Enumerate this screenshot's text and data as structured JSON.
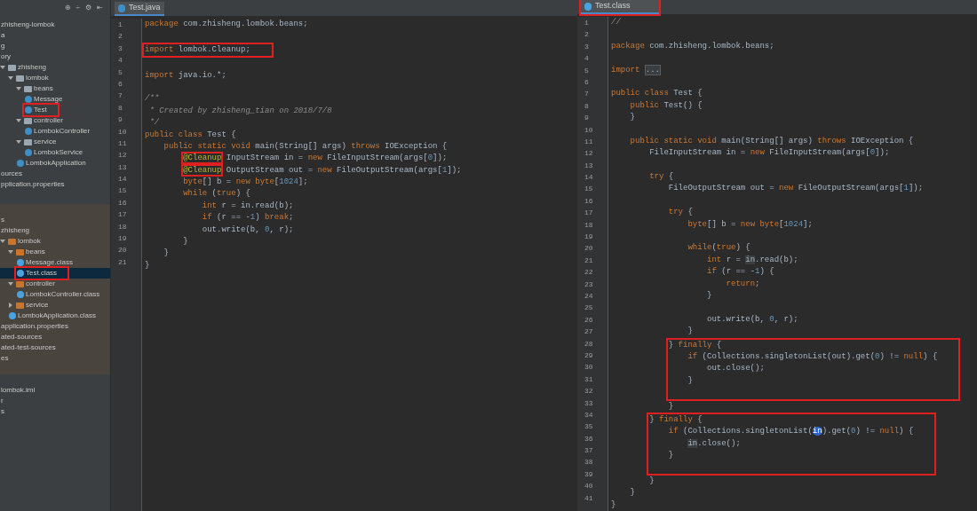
{
  "sidebar": {
    "toolbar": [
      "⊕",
      "÷",
      "⚙",
      "⇤"
    ],
    "sections": [
      {
        "kind": "source",
        "nodes": [
          {
            "kind": "text",
            "label": "zhisheng-lombok"
          },
          {
            "kind": "text",
            "label": "a"
          },
          {
            "kind": "text",
            "label": "g"
          },
          {
            "kind": "text",
            "label": "ory"
          },
          {
            "kind": "folder",
            "label": "zhisheng",
            "expanded": true,
            "children": [
              {
                "kind": "folder",
                "label": "lombok",
                "expanded": true,
                "children": [
                  {
                    "kind": "folder",
                    "label": "beans",
                    "expanded": true,
                    "children": [
                      {
                        "kind": "java",
                        "label": "Message",
                        "selected": false,
                        "boxed": false
                      },
                      {
                        "kind": "java",
                        "label": "Test",
                        "selected": false,
                        "boxed": true
                      }
                    ]
                  },
                  {
                    "kind": "folder",
                    "label": "controller",
                    "expanded": true,
                    "children": [
                      {
                        "kind": "java",
                        "label": "LombokController",
                        "selected": false,
                        "boxed": false
                      }
                    ]
                  },
                  {
                    "kind": "folder",
                    "label": "service",
                    "expanded": true,
                    "children": [
                      {
                        "kind": "java",
                        "label": "LombokService",
                        "selected": false,
                        "boxed": false
                      }
                    ]
                  },
                  {
                    "kind": "java",
                    "label": "LombokApplication",
                    "selected": false,
                    "boxed": false
                  }
                ]
              }
            ]
          },
          {
            "kind": "text",
            "label": "ources"
          },
          {
            "kind": "text",
            "label": "pplication.properties"
          }
        ]
      },
      {
        "kind": "excluded",
        "nodes": [
          {
            "kind": "text",
            "label": "s"
          },
          {
            "kind": "text",
            "label": "zhisheng"
          },
          {
            "kind": "folder",
            "label": "lombok",
            "expanded": true,
            "children": [
              {
                "kind": "folder",
                "label": "beans",
                "expanded": true,
                "children": [
                  {
                    "kind": "class",
                    "label": "Message.class",
                    "selected": false,
                    "boxed": false
                  },
                  {
                    "kind": "class",
                    "label": "Test.class",
                    "selected": true,
                    "boxed": true
                  }
                ]
              },
              {
                "kind": "folder",
                "label": "controller",
                "expanded": true,
                "children": [
                  {
                    "kind": "class",
                    "label": "LombokController.class",
                    "selected": false,
                    "boxed": false
                  }
                ]
              },
              {
                "kind": "folder",
                "label": "service",
                "expanded": false
              },
              {
                "kind": "class",
                "label": "LombokApplication.class",
                "selected": false,
                "boxed": false
              }
            ]
          },
          {
            "kind": "text",
            "label": "application.properties"
          },
          {
            "kind": "text",
            "label": "ated-sources"
          },
          {
            "kind": "text",
            "label": "ated-test-sources"
          },
          {
            "kind": "text",
            "label": "es"
          }
        ]
      },
      {
        "kind": "plain",
        "nodes": [
          {
            "kind": "text",
            "label": "lombok.iml"
          },
          {
            "kind": "text",
            "label": "r"
          },
          {
            "kind": "text",
            "label": "s"
          }
        ]
      }
    ]
  },
  "editors": [
    {
      "tab": {
        "label": "Test.java",
        "selected": true,
        "boxed": false,
        "kind": "java"
      },
      "lines": [
        {
          "n": "1",
          "tokens": [
            {
              "kind": "k",
              "text": "package"
            },
            {
              "kind": "t",
              "text": " com.zhisheng.lombok.beans;"
            }
          ]
        },
        {
          "n": "2"
        },
        {
          "n": "3",
          "boxed": true,
          "tokens": [
            {
              "kind": "k",
              "text": "import"
            },
            {
              "kind": "t",
              "text": " lombok.Cleanup;"
            }
          ]
        },
        {
          "n": "4"
        },
        {
          "n": "5",
          "tokens": [
            {
              "kind": "k",
              "text": "import"
            },
            {
              "kind": "t",
              "text": " java.io.*;"
            }
          ]
        },
        {
          "n": "6"
        },
        {
          "n": "7",
          "tokens": [
            {
              "kind": "c",
              "text": "/**"
            }
          ]
        },
        {
          "n": "8",
          "tokens": [
            {
              "kind": "c",
              "text": " * Created by zhisheng_tian on 2018/7/8"
            }
          ]
        },
        {
          "n": "9",
          "tokens": [
            {
              "kind": "c",
              "text": " */"
            }
          ]
        },
        {
          "n": "10",
          "tokens": [
            {
              "kind": "k",
              "text": "public class"
            },
            {
              "kind": "t",
              "text": " Test {"
            }
          ]
        },
        {
          "n": "11",
          "tokens": [
            {
              "kind": "k",
              "text": "    public static void"
            },
            {
              "kind": "t",
              "text": " main(String[] args) "
            },
            {
              "kind": "k",
              "text": "throws"
            },
            {
              "kind": "t",
              "text": " IOException {"
            }
          ]
        },
        {
          "n": "12",
          "tokens": [
            {
              "kind": "ab",
              "text": "        @Cleanup"
            },
            {
              "kind": "t",
              "text": " InputStream in = "
            },
            {
              "kind": "k",
              "text": "new"
            },
            {
              "kind": "t",
              "text": " FileInputStream(args["
            },
            {
              "kind": "num",
              "text": "0"
            },
            {
              "kind": "t",
              "text": "]);"
            }
          ]
        },
        {
          "n": "13",
          "tokens": [
            {
              "kind": "ab",
              "text": "        @Cleanup"
            },
            {
              "kind": "t",
              "text": " OutputStream out = "
            },
            {
              "kind": "k",
              "text": "new"
            },
            {
              "kind": "t",
              "text": " FileOutputStream(args["
            },
            {
              "kind": "num",
              "text": "1"
            },
            {
              "kind": "t",
              "text": "]);"
            }
          ]
        },
        {
          "n": "14",
          "tokens": [
            {
              "kind": "k",
              "text": "        byte"
            },
            {
              "kind": "t",
              "text": "[] b = "
            },
            {
              "kind": "k",
              "text": "new byte"
            },
            {
              "kind": "t",
              "text": "["
            },
            {
              "kind": "num",
              "text": "1024"
            },
            {
              "kind": "t",
              "text": "];"
            }
          ]
        },
        {
          "n": "15",
          "tokens": [
            {
              "kind": "k",
              "text": "        while"
            },
            {
              "kind": "t",
              "text": " ("
            },
            {
              "kind": "k",
              "text": "true"
            },
            {
              "kind": "t",
              "text": ") {"
            }
          ]
        },
        {
          "n": "16",
          "tokens": [
            {
              "kind": "k",
              "text": "            int"
            },
            {
              "kind": "t",
              "text": " r = in.read(b);"
            }
          ]
        },
        {
          "n": "17",
          "tokens": [
            {
              "kind": "k",
              "text": "            if"
            },
            {
              "kind": "t",
              "text": " (r == -"
            },
            {
              "kind": "num",
              "text": "1"
            },
            {
              "kind": "t",
              "text": ") "
            },
            {
              "kind": "k",
              "text": "break"
            },
            {
              "kind": "t",
              "text": ";"
            }
          ]
        },
        {
          "n": "18",
          "tokens": [
            {
              "kind": "t",
              "text": "            out.write(b, "
            },
            {
              "kind": "num",
              "text": "0"
            },
            {
              "kind": "t",
              "text": ", r);"
            }
          ]
        },
        {
          "n": "19",
          "tokens": [
            {
              "kind": "t",
              "text": "        }"
            }
          ]
        },
        {
          "n": "20",
          "tokens": [
            {
              "kind": "t",
              "text": "    }"
            }
          ]
        },
        {
          "n": "21",
          "tokens": [
            {
              "kind": "t",
              "text": "}"
            }
          ]
        }
      ]
    },
    {
      "tab": {
        "label": "Test.class",
        "selected": true,
        "boxed": true,
        "kind": "class"
      },
      "lines": [
        {
          "n": "1",
          "tokens": [
            {
              "kind": "c",
              "text": "//"
            }
          ]
        },
        {
          "n": "2"
        },
        {
          "n": "3",
          "tokens": [
            {
              "kind": "k",
              "text": "package"
            },
            {
              "kind": "t",
              "text": " com.zhisheng.lombok.beans;"
            }
          ]
        },
        {
          "n": "4"
        },
        {
          "n": "5",
          "tokens": [
            {
              "kind": "k",
              "text": "import "
            },
            {
              "kind": "fold",
              "text": "..."
            }
          ]
        },
        {
          "n": "6"
        },
        {
          "n": "7",
          "tokens": [
            {
              "kind": "k",
              "text": "public class"
            },
            {
              "kind": "t",
              "text": " Test {"
            }
          ]
        },
        {
          "n": "8",
          "tokens": [
            {
              "kind": "k",
              "text": "    public"
            },
            {
              "kind": "t",
              "text": " Test() {"
            }
          ]
        },
        {
          "n": "9",
          "tokens": [
            {
              "kind": "t",
              "text": "    }"
            }
          ]
        },
        {
          "n": "10"
        },
        {
          "n": "11",
          "tokens": [
            {
              "kind": "k",
              "text": "    public static void"
            },
            {
              "kind": "t",
              "text": " main(String[] args) "
            },
            {
              "kind": "k",
              "text": "throws"
            },
            {
              "kind": "t",
              "text": " IOException {"
            }
          ]
        },
        {
          "n": "12",
          "tokens": [
            {
              "kind": "t",
              "text": "        FileInputStream in = "
            },
            {
              "kind": "k",
              "text": "new"
            },
            {
              "kind": "t",
              "text": " FileInputStream(args["
            },
            {
              "kind": "num",
              "text": "0"
            },
            {
              "kind": "t",
              "text": "]);"
            }
          ]
        },
        {
          "n": "13"
        },
        {
          "n": "14",
          "tokens": [
            {
              "kind": "k",
              "text": "        try"
            },
            {
              "kind": "t",
              "text": " {"
            }
          ]
        },
        {
          "n": "15",
          "tokens": [
            {
              "kind": "t",
              "text": "            FileOutputStream out = "
            },
            {
              "kind": "k",
              "text": "new"
            },
            {
              "kind": "t",
              "text": " FileOutputStream(args["
            },
            {
              "kind": "num",
              "text": "1"
            },
            {
              "kind": "t",
              "text": "]);"
            }
          ]
        },
        {
          "n": "16"
        },
        {
          "n": "17",
          "tokens": [
            {
              "kind": "k",
              "text": "            try"
            },
            {
              "kind": "t",
              "text": " {"
            }
          ]
        },
        {
          "n": "18",
          "tokens": [
            {
              "kind": "k",
              "text": "                byte"
            },
            {
              "kind": "t",
              "text": "[] b = "
            },
            {
              "kind": "k",
              "text": "new byte"
            },
            {
              "kind": "t",
              "text": "["
            },
            {
              "kind": "num",
              "text": "1024"
            },
            {
              "kind": "t",
              "text": "];"
            }
          ]
        },
        {
          "n": "19"
        },
        {
          "n": "20",
          "tokens": [
            {
              "kind": "k",
              "text": "                while"
            },
            {
              "kind": "t",
              "text": "("
            },
            {
              "kind": "k",
              "text": "true"
            },
            {
              "kind": "t",
              "text": ") {"
            }
          ]
        },
        {
          "n": "21",
          "tokens": [
            {
              "kind": "k",
              "text": "                    int"
            },
            {
              "kind": "t",
              "text": " r = "
            },
            {
              "kind": "hl",
              "text": "in"
            },
            {
              "kind": "t",
              "text": ".read(b);"
            }
          ]
        },
        {
          "n": "22",
          "tokens": [
            {
              "kind": "k",
              "text": "                    if"
            },
            {
              "kind": "t",
              "text": " (r == -"
            },
            {
              "kind": "num",
              "text": "1"
            },
            {
              "kind": "t",
              "text": ") {"
            }
          ]
        },
        {
          "n": "23",
          "tokens": [
            {
              "kind": "k",
              "text": "                        return"
            },
            {
              "kind": "t",
              "text": ";"
            }
          ]
        },
        {
          "n": "24",
          "tokens": [
            {
              "kind": "t",
              "text": "                    }"
            }
          ]
        },
        {
          "n": "25"
        },
        {
          "n": "26",
          "tokens": [
            {
              "kind": "t",
              "text": "                    out.write(b, "
            },
            {
              "kind": "num",
              "text": "0"
            },
            {
              "kind": "t",
              "text": ", r);"
            }
          ]
        },
        {
          "n": "27",
          "tokens": [
            {
              "kind": "t",
              "text": "                }"
            }
          ]
        },
        {
          "n": "28",
          "boxed": true,
          "tokens": [
            {
              "kind": "t",
              "text": "            } "
            },
            {
              "kind": "k",
              "text": "finally"
            },
            {
              "kind": "t",
              "text": " {"
            }
          ]
        },
        {
          "n": "29",
          "boxed": true,
          "tokens": [
            {
              "kind": "k",
              "text": "                if"
            },
            {
              "kind": "t",
              "text": " (Collections.singletonList(out).get("
            },
            {
              "kind": "num",
              "text": "0"
            },
            {
              "kind": "t",
              "text": ") != "
            },
            {
              "kind": "k",
              "text": "null"
            },
            {
              "kind": "t",
              "text": ") {"
            }
          ]
        },
        {
          "n": "30",
          "boxed": true,
          "tokens": [
            {
              "kind": "t",
              "text": "                    out.close();"
            }
          ]
        },
        {
          "n": "31",
          "boxed": true,
          "tokens": [
            {
              "kind": "t",
              "text": "                }"
            }
          ]
        },
        {
          "n": "32",
          "boxed": true
        },
        {
          "n": "33",
          "tokens": [
            {
              "kind": "t",
              "text": "            }"
            }
          ]
        },
        {
          "n": "34",
          "boxed": true,
          "tokens": [
            {
              "kind": "t",
              "text": "        } "
            },
            {
              "kind": "k",
              "text": "finally"
            },
            {
              "kind": "t",
              "text": " {"
            }
          ]
        },
        {
          "n": "35",
          "boxed": true,
          "tokens": [
            {
              "kind": "k",
              "text": "            if"
            },
            {
              "kind": "t",
              "text": " (Collections.singletonList("
            },
            {
              "kind": "sel",
              "text": "in"
            },
            {
              "kind": "t",
              "text": ").get("
            },
            {
              "kind": "num",
              "text": "0"
            },
            {
              "kind": "t",
              "text": ") != "
            },
            {
              "kind": "k",
              "text": "null"
            },
            {
              "kind": "t",
              "text": ") {"
            }
          ]
        },
        {
          "n": "36",
          "boxed": true,
          "tokens": [
            {
              "kind": "hl",
              "text": "                in"
            },
            {
              "kind": "t",
              "text": ".close();"
            }
          ]
        },
        {
          "n": "37",
          "boxed": true,
          "tokens": [
            {
              "kind": "t",
              "text": "            }"
            }
          ]
        },
        {
          "n": "38",
          "boxed": true
        },
        {
          "n": "39",
          "tokens": [
            {
              "kind": "t",
              "text": "        }"
            }
          ]
        },
        {
          "n": "40",
          "tokens": [
            {
              "kind": "t",
              "text": "    }"
            }
          ]
        },
        {
          "n": "41",
          "tokens": [
            {
              "kind": "t",
              "text": "}"
            }
          ]
        }
      ]
    }
  ]
}
